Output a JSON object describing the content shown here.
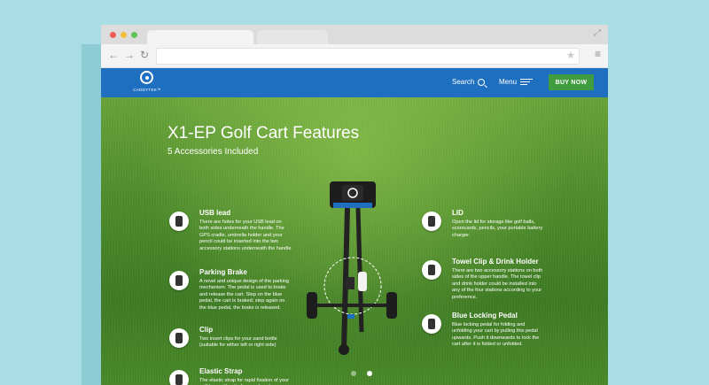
{
  "header": {
    "logo_text": "CADDYTEK™",
    "search_label": "Search",
    "menu_label": "Menu",
    "buy_label": "BUY NOW"
  },
  "hero": {
    "title": "X1-EP Golf Cart Features",
    "subtitle": "5 Accessories Included"
  },
  "features_left": [
    {
      "title": "USB lead",
      "desc": "There are holes for your USB lead on both sides underneath the handle. The GPS cradle, umbrella holder and your pencil could be inserted into the two accessory stations underneath the handle"
    },
    {
      "title": "Parking Brake",
      "desc": "A novel and unique design of the parking mechanism. The pedal is used to brake and release the cart. Step on the blue pedal, the cart is braked; step again on the blue pedal, the brake is released."
    },
    {
      "title": "Clip",
      "desc": "Two insert clips for your sand bottle (suitable for either left or right side)"
    },
    {
      "title": "Elastic Strap",
      "desc": "The elastic strap for rapid fixation of your golf bag, with a tie for your handy use."
    }
  ],
  "features_right": [
    {
      "title": "LID",
      "desc": "Open the lid for storage like golf balls, scorecards, pencils, your portable battery charger."
    },
    {
      "title": "Towel Clip & Drink Holder",
      "desc": "There are two accessory stations on both sides of the upper handle. The towel clip and drink holder could be installed into any of the four stations according to your preference."
    },
    {
      "title": "Blue Locking Pedal",
      "desc": "Blue locking pedal for folding and unfolding your cart by pulling this pedal upwards. Push it downwards to lock the cart after it is folded or unfolded."
    }
  ],
  "slider": {
    "count": 2,
    "active_index": 1
  },
  "colors": {
    "header": "#1f6fc1",
    "buy_button": "#3f9c3f",
    "background": "#a9dde5"
  }
}
